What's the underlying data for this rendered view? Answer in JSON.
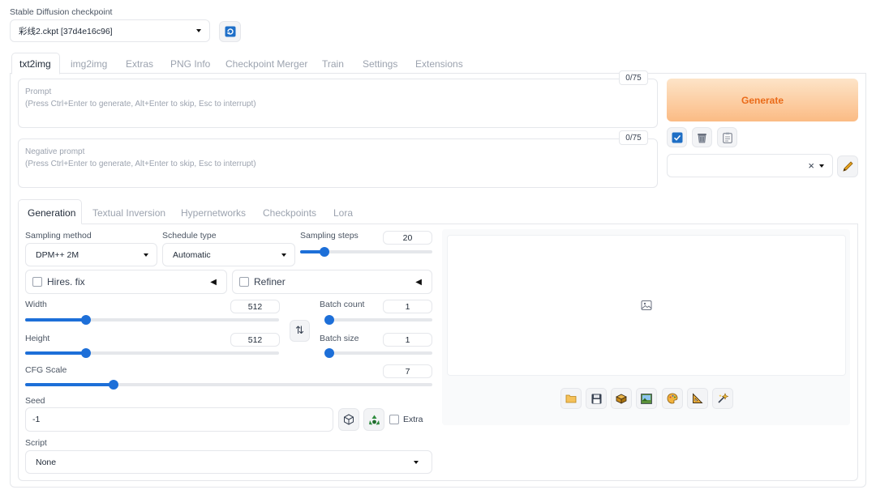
{
  "checkpoint": {
    "label": "Stable Diffusion checkpoint",
    "value": "彩线2.ckpt [37d4e16c96]"
  },
  "main_tabs": [
    "txt2img",
    "img2img",
    "Extras",
    "PNG Info",
    "Checkpoint Merger",
    "Train",
    "Settings",
    "Extensions"
  ],
  "prompt": {
    "counter": "0/75",
    "label": "Prompt",
    "hint": "(Press Ctrl+Enter to generate, Alt+Enter to skip, Esc to interrupt)"
  },
  "negative_prompt": {
    "counter": "0/75",
    "label": "Negative prompt",
    "hint": "(Press Ctrl+Enter to generate, Alt+Enter to skip, Esc to interrupt)"
  },
  "generate_label": "Generate",
  "style_clear": "×",
  "sub_tabs": [
    "Generation",
    "Textual Inversion",
    "Hypernetworks",
    "Checkpoints",
    "Lora"
  ],
  "sampling_method": {
    "label": "Sampling method",
    "value": "DPM++ 2M"
  },
  "schedule_type": {
    "label": "Schedule type",
    "value": "Automatic"
  },
  "sampling_steps": {
    "label": "Sampling steps",
    "value": "20",
    "level": 0.16
  },
  "hires_fix": "Hires. fix",
  "refiner": "Refiner",
  "collapse_arrow": "◀",
  "width": {
    "label": "Width",
    "value": "512",
    "level": 0.23
  },
  "height": {
    "label": "Height",
    "value": "512",
    "level": 0.23
  },
  "swap_icon": "⇅",
  "batch_count": {
    "label": "Batch count",
    "value": "1",
    "level": 0.0
  },
  "batch_size": {
    "label": "Batch size",
    "value": "1",
    "level": 0.0
  },
  "cfg_scale": {
    "label": "CFG Scale",
    "value": "7",
    "level": 0.21
  },
  "seed": {
    "label": "Seed",
    "value": "-1",
    "extra": "Extra"
  },
  "script": {
    "label": "Script",
    "value": "None"
  },
  "colors": {
    "accent": "#1d6fd8",
    "generate_start": "#fde2c4",
    "generate_end": "#fbbf88",
    "generate_text": "#ea6a18"
  }
}
